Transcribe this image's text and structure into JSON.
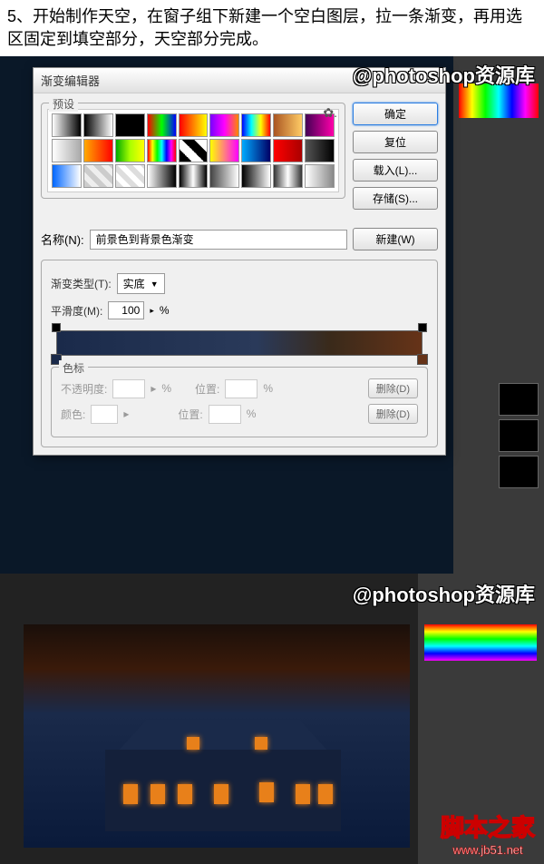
{
  "instruction": "5、开始制作天空，在窗子组下新建一个空白图层，拉一条渐变，再用选区固定到填空部分，天空部分完成。",
  "watermark": "@photoshop资源库",
  "dialog": {
    "title": "渐变编辑器",
    "presets_label": "预设",
    "buttons": {
      "ok": "确定",
      "cancel": "复位",
      "load": "载入(L)...",
      "save": "存储(S)..."
    },
    "name_label": "名称(N):",
    "name_value": "前景色到背景色渐变",
    "new_btn": "新建(W)",
    "gradient_type_label": "渐变类型(T):",
    "gradient_type_value": "实底",
    "smoothness_label": "平滑度(M):",
    "smoothness_value": "100",
    "smoothness_unit": "%",
    "stops_label": "色标",
    "opacity_label": "不透明度:",
    "position_label": "位置:",
    "color_label": "颜色:",
    "percent": "%",
    "delete_btn": "删除(D)",
    "swatch_gradients": [
      "linear-gradient(90deg,#fff,#000)",
      "linear-gradient(90deg,#000,#fff)",
      "linear-gradient(90deg,#000,#000)",
      "linear-gradient(90deg,#f00,#0f0,#00f)",
      "linear-gradient(90deg,#f00,#ff0)",
      "linear-gradient(90deg,#70f,#f0f,#f80)",
      "linear-gradient(90deg,#00f,#0ff,#ff0,#f00)",
      "linear-gradient(90deg,#a52,#fc6)",
      "linear-gradient(90deg,#405,#f0a)",
      "linear-gradient(90deg,#fff,#aaa)",
      "linear-gradient(90deg,#fa0,#f00)",
      "linear-gradient(90deg,#0a0,#af0,#ff0)",
      "linear-gradient(90deg,#f00,#ff0,#0f0,#0ff,#00f,#f0f,#f00)",
      "linear-gradient(45deg,#000 25%,#fff 25%,#fff 50%,#000 50%,#000 75%,#fff 75%)",
      "linear-gradient(90deg,#ff0,#f0f)",
      "linear-gradient(90deg,#0af,#006)",
      "linear-gradient(90deg,#f00,#a00)",
      "linear-gradient(90deg,#555,#000)",
      "linear-gradient(90deg,#06f,#fff)",
      "repeating-linear-gradient(45deg,#ccc 0 6px,#eee 6px 12px)",
      "repeating-linear-gradient(45deg,#ddd 0 6px,#fff 6px 12px)",
      "linear-gradient(90deg,#fff,#000)",
      "linear-gradient(90deg,#000,#fff,#000)",
      "linear-gradient(90deg,#444,#fff)",
      "linear-gradient(90deg,#000,#fff)",
      "linear-gradient(90deg,#333,#fff,#333)",
      "linear-gradient(90deg,#fff,#888)"
    ]
  },
  "brand": {
    "cn": "脚本之家",
    "url": "www.jb51.net"
  }
}
